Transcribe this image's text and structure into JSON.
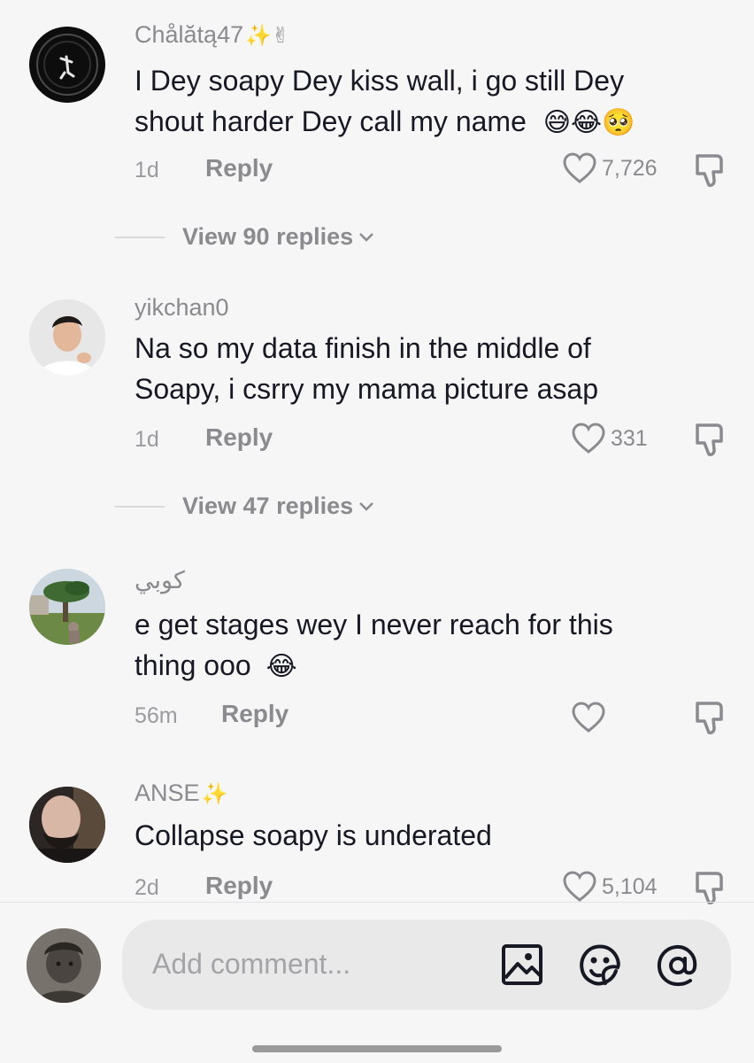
{
  "comments": [
    {
      "username": "Chålătą47",
      "username_deco": "✨✌",
      "text_lines": [
        "I Dey soapy Dey kiss wall, i go still Dey",
        "shout harder Dey call my name"
      ],
      "emojis": [
        "😅",
        "😂",
        "🥺"
      ],
      "time": "1d",
      "reply_label": "Reply",
      "likes": "7,726",
      "view_replies": "View 90 replies"
    },
    {
      "username": "yikchan0",
      "username_deco": "",
      "text_lines": [
        "Na so my data finish in the middle of",
        "Soapy, i csrry my mama picture asap"
      ],
      "emojis": [],
      "time": "1d",
      "reply_label": "Reply",
      "likes": "331",
      "view_replies": "View 47 replies"
    },
    {
      "username": "كوبي",
      "username_deco": "",
      "text_lines": [
        "e get stages wey I never reach for this",
        "thing ooo"
      ],
      "emojis": [
        "😂"
      ],
      "time": "56m",
      "reply_label": "Reply",
      "likes": ""
    },
    {
      "username": "ANSE",
      "username_deco": "✨",
      "text_lines": [
        "Collapse soapy is underated"
      ],
      "emojis": [],
      "time": "2d",
      "reply_label": "Reply",
      "likes": "5,104"
    }
  ],
  "composer": {
    "placeholder": "Add comment...",
    "icons": [
      "image-icon",
      "emoji-icon",
      "mention-icon"
    ]
  },
  "colors": {
    "background": "#f6f6f6",
    "text": "#161823",
    "muted": "#8a8a8f"
  }
}
